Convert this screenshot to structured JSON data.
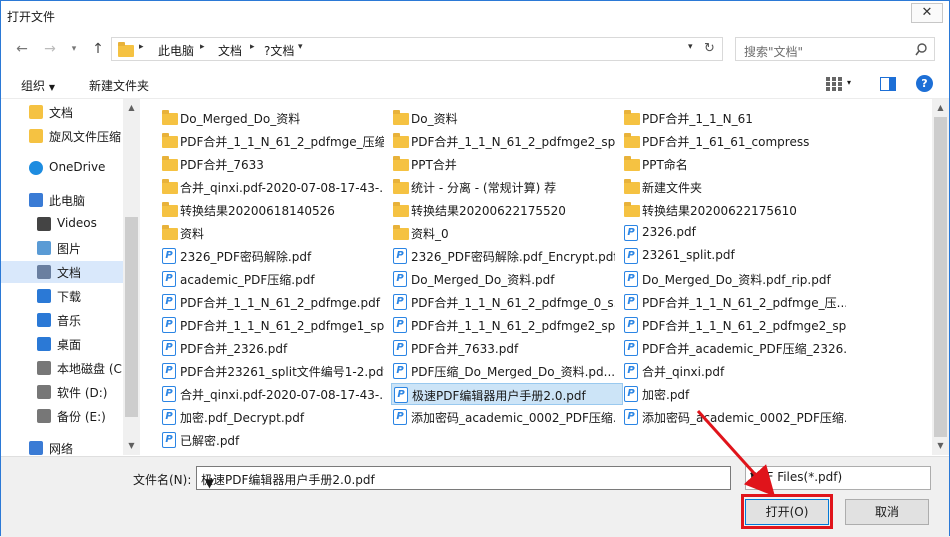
{
  "window": {
    "title": "打开文件",
    "close_glyph": "✕"
  },
  "nav": {
    "back": "←",
    "forward": "→",
    "dropdown": "▾",
    "up": "↑",
    "refresh": "↻"
  },
  "breadcrumb": [
    "此电脑",
    "文档",
    "?文档"
  ],
  "search": {
    "placeholder": "搜索\"文档\""
  },
  "toolbar": {
    "organize": "组织",
    "new_folder": "新建文件夹"
  },
  "sidebar": {
    "items": [
      {
        "label": "文档",
        "icon": "folder-icon"
      },
      {
        "label": "旋风文件压缩",
        "icon": "folder-icon"
      },
      {
        "label": "OneDrive",
        "icon": "cloud-icon"
      },
      {
        "label": "此电脑",
        "icon": "computer-icon"
      },
      {
        "label": "Videos",
        "icon": "video-icon"
      },
      {
        "label": "图片",
        "icon": "picture-icon"
      },
      {
        "label": "文档",
        "icon": "document-icon"
      },
      {
        "label": "下载",
        "icon": "download-icon"
      },
      {
        "label": "音乐",
        "icon": "music-icon"
      },
      {
        "label": "桌面",
        "icon": "desktop-icon"
      },
      {
        "label": "本地磁盘 (C:",
        "icon": "drive-icon"
      },
      {
        "label": "软件 (D:)",
        "icon": "drive-icon"
      },
      {
        "label": "备份 (E:)",
        "icon": "drive-icon"
      },
      {
        "label": "网络",
        "icon": "network-icon"
      }
    ]
  },
  "files": [
    {
      "name": "Do_Merged_Do_资料",
      "type": "folder"
    },
    {
      "name": "Do_资料",
      "type": "folder"
    },
    {
      "name": "PDF合并_1_1_N_61",
      "type": "folder"
    },
    {
      "name": "PDF合并_1_1_N_61_2_pdfmge_压缩",
      "type": "folder"
    },
    {
      "name": "PDF合并_1_1_N_61_2_pdfmge2_sp...",
      "type": "folder"
    },
    {
      "name": "PDF合并_1_61_61_compress",
      "type": "folder"
    },
    {
      "name": "PDF合并_7633",
      "type": "folder"
    },
    {
      "name": "PPT合并",
      "type": "folder"
    },
    {
      "name": "PPT命名",
      "type": "folder"
    },
    {
      "name": "合并_qinxi.pdf-2020-07-08-17-43-...",
      "type": "folder"
    },
    {
      "name": "统计 - 分离 - (常规计算) 荐",
      "type": "folder"
    },
    {
      "name": "新建文件夹",
      "type": "folder"
    },
    {
      "name": "转换结果20200618140526",
      "type": "folder"
    },
    {
      "name": "转换结果20200622175520",
      "type": "folder"
    },
    {
      "name": "转换结果20200622175610",
      "type": "folder"
    },
    {
      "name": "资料",
      "type": "folder"
    },
    {
      "name": "资料_0",
      "type": "folder"
    },
    {
      "name": "2326.pdf",
      "type": "pdf"
    },
    {
      "name": "2326_PDF密码解除.pdf",
      "type": "pdf"
    },
    {
      "name": "2326_PDF密码解除.pdf_Encrypt.pdf",
      "type": "pdf"
    },
    {
      "name": "23261_split.pdf",
      "type": "pdf"
    },
    {
      "name": "academic_PDF压缩.pdf",
      "type": "pdf"
    },
    {
      "name": "Do_Merged_Do_资料.pdf",
      "type": "pdf"
    },
    {
      "name": "Do_Merged_Do_资料.pdf_rip.pdf",
      "type": "pdf"
    },
    {
      "name": "PDF合并_1_1_N_61_2_pdfmge.pdf",
      "type": "pdf"
    },
    {
      "name": "PDF合并_1_1_N_61_2_pdfmge_0_s...",
      "type": "pdf"
    },
    {
      "name": "PDF合并_1_1_N_61_2_pdfmge_压...",
      "type": "pdf"
    },
    {
      "name": "PDF合并_1_1_N_61_2_pdfmge1_sp...",
      "type": "pdf"
    },
    {
      "name": "PDF合并_1_1_N_61_2_pdfmge2_sp...",
      "type": "pdf"
    },
    {
      "name": "PDF合并_1_1_N_61_2_pdfmge2_sp...",
      "type": "pdf"
    },
    {
      "name": "PDF合并_2326.pdf",
      "type": "pdf"
    },
    {
      "name": "PDF合并_7633.pdf",
      "type": "pdf"
    },
    {
      "name": "PDF合并_academic_PDF压缩_2326....",
      "type": "pdf"
    },
    {
      "name": "PDF合并23261_split文件编号1-2.pdf",
      "type": "pdf"
    },
    {
      "name": "PDF压缩_Do_Merged_Do_资料.pd...",
      "type": "pdf"
    },
    {
      "name": "合并_qinxi.pdf",
      "type": "pdf"
    },
    {
      "name": "合并_qinxi.pdf-2020-07-08-17-43-...",
      "type": "pdf"
    },
    {
      "name": "极速PDF编辑器用户手册2.0.pdf",
      "type": "pdf",
      "selected": true
    },
    {
      "name": "加密.pdf",
      "type": "pdf"
    },
    {
      "name": "加密.pdf_Decrypt.pdf",
      "type": "pdf"
    },
    {
      "name": "添加密码_academic_0002_PDF压缩...",
      "type": "pdf"
    },
    {
      "name": "添加密码_academic_0002_PDF压缩...",
      "type": "pdf"
    },
    {
      "name": "已解密.pdf",
      "type": "pdf"
    }
  ],
  "bottom": {
    "filename_label": "文件名(N):",
    "filename_value": "极速PDF编辑器用户手册2.0.pdf",
    "filter_value": "PDF Files(*.pdf)",
    "open_label": "打开(O)",
    "cancel_label": "取消"
  },
  "colors": {
    "accent": "#1d6fd6",
    "highlight": "#e0141b",
    "selection": "#cce4f7"
  }
}
